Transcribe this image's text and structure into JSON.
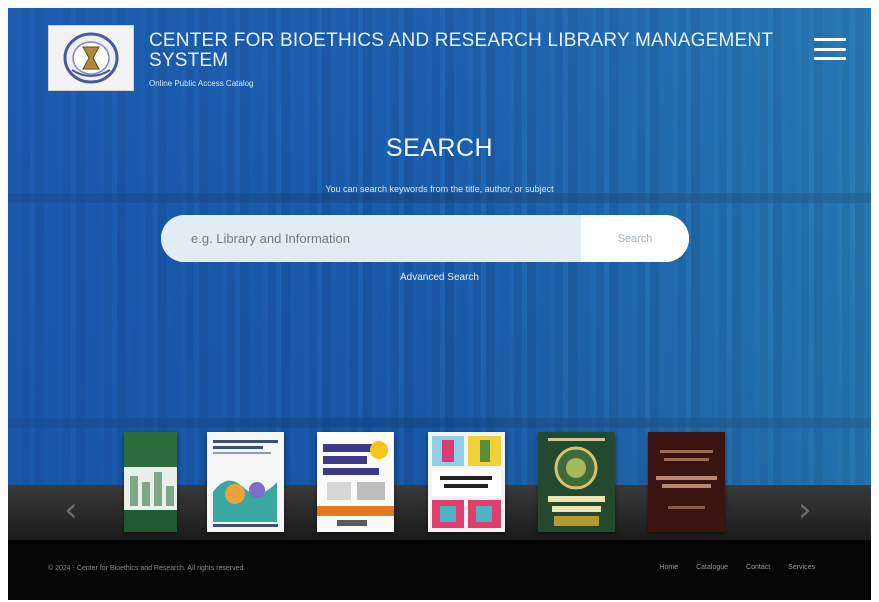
{
  "header": {
    "title": "CENTER FOR BIOETHICS AND RESEARCH LIBRARY MANAGEMENT SYSTEM",
    "subtitle": "Online Public Access Catalog",
    "logo_icon": "seal-logo-icon",
    "menu_icon": "hamburger-menu-icon"
  },
  "search": {
    "heading": "SEARCH",
    "hint": "You can search keywords from the title, author, or subject",
    "placeholder": "e.g. Library and Information",
    "button_label": "Search",
    "advanced_link": "Advanced Search"
  },
  "carousel": {
    "prev_label": "‹",
    "next_label": "›",
    "book_count": 6
  },
  "footer": {
    "copyright": "© 2024 - Center for Bioethics and Research. All rights reserved.",
    "nav": [
      "Home",
      "Catalogue",
      "Contact",
      "Services"
    ]
  },
  "colors": {
    "hero_blue": "#2f6fb3",
    "footer_bg": "#050505",
    "carousel_bg": "#1b1b1b"
  }
}
